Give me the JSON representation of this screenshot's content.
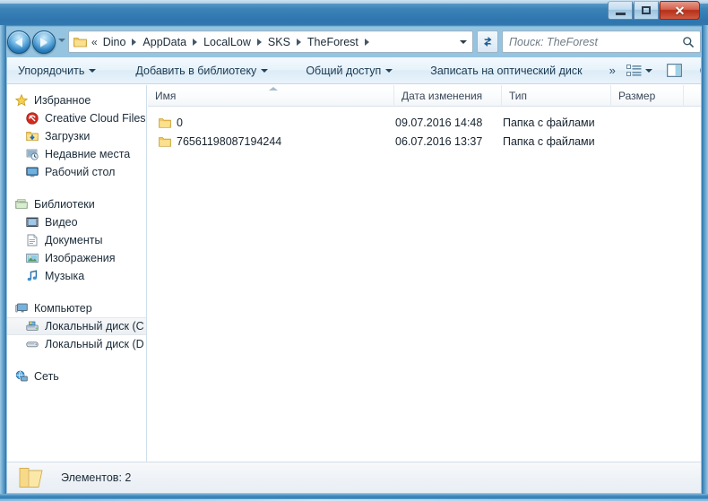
{
  "window": {
    "controls": {
      "minimize_label": "–",
      "maximize_label": "",
      "close_label": "✕"
    }
  },
  "addressbar": {
    "back_tooltip": "Назад",
    "forward_tooltip": "Вперед",
    "leading_chevron": "«",
    "crumbs": [
      "Dino",
      "AppData",
      "LocalLow",
      "SKS",
      "TheForest"
    ],
    "refresh_label": "↻"
  },
  "search": {
    "placeholder": "Поиск: TheForest"
  },
  "toolbar": {
    "organize_label": "Упорядочить",
    "add_to_library_label": "Добавить в библиотеку",
    "share_label": "Общий доступ",
    "burn_label": "Записать на оптический диск",
    "overflow_label": "»"
  },
  "sidebar": {
    "groups": [
      {
        "header": {
          "label": "Избранное",
          "icon": "star-icon"
        },
        "items": [
          {
            "label": "Creative Cloud Files",
            "icon": "creative-cloud-icon"
          },
          {
            "label": "Загрузки",
            "icon": "downloads-icon"
          },
          {
            "label": "Недавние места",
            "icon": "recent-places-icon"
          },
          {
            "label": "Рабочий стол",
            "icon": "desktop-icon"
          }
        ]
      },
      {
        "header": {
          "label": "Библиотеки",
          "icon": "libraries-icon"
        },
        "items": [
          {
            "label": "Видео",
            "icon": "video-icon"
          },
          {
            "label": "Документы",
            "icon": "documents-icon"
          },
          {
            "label": "Изображения",
            "icon": "pictures-icon"
          },
          {
            "label": "Музыка",
            "icon": "music-icon"
          }
        ]
      },
      {
        "header": {
          "label": "Компьютер",
          "icon": "computer-icon"
        },
        "items": [
          {
            "label": "Локальный диск (C",
            "icon": "system-drive-icon",
            "selected": true
          },
          {
            "label": "Локальный диск (D",
            "icon": "drive-icon",
            "selected": false
          }
        ]
      },
      {
        "header": {
          "label": "Сеть",
          "icon": "network-icon"
        },
        "items": []
      }
    ]
  },
  "filelist": {
    "columns": [
      {
        "label": "Имя"
      },
      {
        "label": "Дата изменения"
      },
      {
        "label": "Тип"
      },
      {
        "label": "Размер"
      }
    ],
    "sort_column": "Имя",
    "sort_direction": "ascending",
    "rows": [
      {
        "name": "0",
        "date_modified": "09.07.2016 14:48",
        "type": "Папка с файлами",
        "size": ""
      },
      {
        "name": "76561198087194244",
        "date_modified": "06.07.2016 13:37",
        "type": "Папка с файлами",
        "size": ""
      }
    ]
  },
  "statusbar": {
    "text": "Элементов: 2"
  },
  "colors": {
    "frame_blue": "#2f76ae",
    "close_red": "#b52f18",
    "folder_yellow": "#f6d678",
    "accent_link": "#1b3a52"
  }
}
